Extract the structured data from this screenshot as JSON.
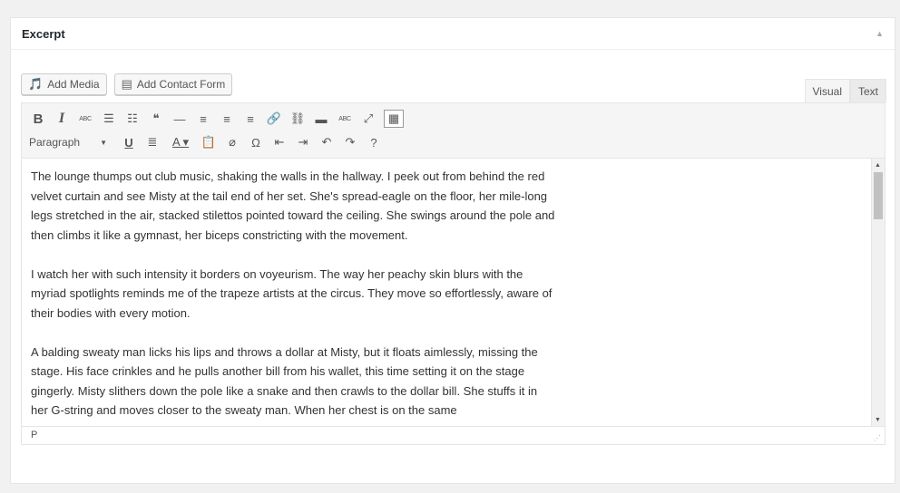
{
  "postbox": {
    "title": "Excerpt"
  },
  "media_buttons": {
    "add_media": "Add Media",
    "add_contact_form": "Add Contact Form"
  },
  "tabs": {
    "visual": "Visual",
    "text": "Text"
  },
  "toolbar": {
    "row1": [
      {
        "name": "bold-button",
        "glyph": "B"
      },
      {
        "name": "italic-button",
        "glyph": "I"
      },
      {
        "name": "strikethrough-button",
        "glyph": "ABC"
      },
      {
        "name": "bulleted-list-button",
        "glyph": "☰"
      },
      {
        "name": "numbered-list-button",
        "glyph": "☷"
      },
      {
        "name": "blockquote-button",
        "glyph": "❝"
      },
      {
        "name": "horizontal-line-button",
        "glyph": "—"
      },
      {
        "name": "align-left-button",
        "glyph": "≡"
      },
      {
        "name": "align-center-button",
        "glyph": "≡"
      },
      {
        "name": "align-right-button",
        "glyph": "≡"
      },
      {
        "name": "insert-link-button",
        "glyph": "🔗"
      },
      {
        "name": "remove-link-button",
        "glyph": "⛓"
      },
      {
        "name": "read-more-button",
        "glyph": "▬"
      },
      {
        "name": "spellcheck-button",
        "glyph": "ABC"
      },
      {
        "name": "fullscreen-button",
        "glyph": "⤢"
      },
      {
        "name": "toolbar-toggle-button",
        "glyph": "▦"
      }
    ],
    "format_select": "Paragraph",
    "row2": [
      {
        "name": "underline-button",
        "glyph": "U"
      },
      {
        "name": "justify-button",
        "glyph": "≣"
      },
      {
        "name": "text-color-button",
        "glyph": "A ▾"
      },
      {
        "name": "paste-as-text-button",
        "glyph": "📋"
      },
      {
        "name": "clear-formatting-button",
        "glyph": "⌀"
      },
      {
        "name": "special-character-button",
        "glyph": "Ω"
      },
      {
        "name": "outdent-button",
        "glyph": "⇤"
      },
      {
        "name": "indent-button",
        "glyph": "⇥"
      },
      {
        "name": "undo-button",
        "glyph": "↶"
      },
      {
        "name": "redo-button",
        "glyph": "↷"
      },
      {
        "name": "help-button",
        "glyph": "?"
      }
    ]
  },
  "content": {
    "paragraphs": [
      "The lounge thumps out club music, shaking the walls in the hallway. I peek out from behind the red velvet curtain and see Misty at the tail end of her set. She's spread-eagle on the floor, her mile-long legs stretched in the air, stacked stilettos pointed toward the ceiling. She swings around the pole and then climbs it like a gymnast, her biceps constricting with the movement.",
      "I watch her with such intensity it borders on voyeurism. The way her peachy skin blurs with the myriad spotlights reminds me of the trapeze artists at the circus. They move so effortlessly, aware of their bodies with every motion.",
      "A balding sweaty man licks his lips and throws a dollar at Misty, but it floats aimlessly, missing the stage. His face crinkles and he pulls another bill from his wallet, this time setting it on the stage gingerly. Misty slithers down the pole like a snake and then crawls to the dollar bill. She stuffs it in her G-string and moves closer to the sweaty man. When her chest is on the same"
    ]
  },
  "statusbar": {
    "path": "P"
  },
  "colors": {
    "accent": "#0073aa",
    "border": "#e5e5e5",
    "toolbar_bg": "#f5f5f5"
  }
}
